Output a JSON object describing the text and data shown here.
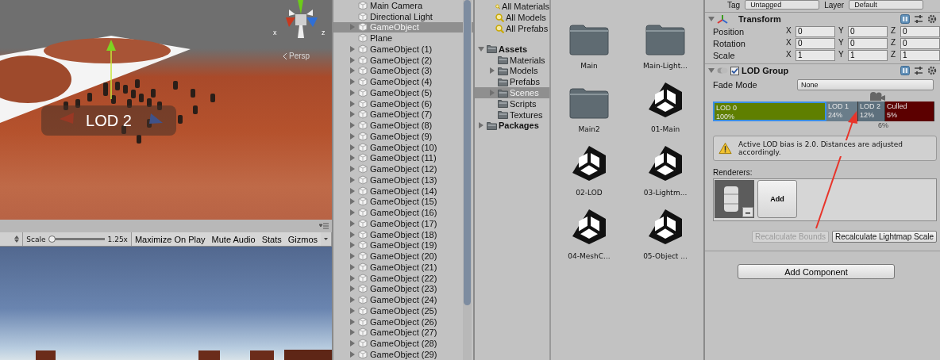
{
  "scene_view": {
    "lod_label": "LOD 2",
    "projection": "Persp",
    "axes": [
      "x",
      "z"
    ]
  },
  "game_view": {
    "toolbar": {
      "scale_label": "Scale",
      "scale": {
        "level": 0.0,
        "reading": "1.25x"
      },
      "buttons": [
        {
          "label": "Maximize On Play",
          "kind": "toggle"
        },
        {
          "label": "Mute Audio",
          "kind": "toggle"
        },
        {
          "label": "Stats",
          "kind": "toggle"
        },
        {
          "label": "Gizmos",
          "kind": "dropdown"
        }
      ]
    }
  },
  "hierarchy": {
    "items": [
      {
        "label": "Main Camera",
        "selected": false,
        "expandable": false
      },
      {
        "label": "Directional Light",
        "selected": false,
        "expandable": false
      },
      {
        "label": "GameObject",
        "selected": true,
        "expandable": true
      },
      {
        "label": "Plane",
        "selected": false,
        "expandable": false
      },
      {
        "label": "GameObject (1)",
        "selected": false,
        "expandable": true
      },
      {
        "label": "GameObject (2)",
        "selected": false,
        "expandable": true
      },
      {
        "label": "GameObject (3)",
        "selected": false,
        "expandable": true
      },
      {
        "label": "GameObject (4)",
        "selected": false,
        "expandable": true
      },
      {
        "label": "GameObject (5)",
        "selected": false,
        "expandable": true
      },
      {
        "label": "GameObject (6)",
        "selected": false,
        "expandable": true
      },
      {
        "label": "GameObject (7)",
        "selected": false,
        "expandable": true
      },
      {
        "label": "GameObject (8)",
        "selected": false,
        "expandable": true
      },
      {
        "label": "GameObject (9)",
        "selected": false,
        "expandable": true
      },
      {
        "label": "GameObject (10)",
        "selected": false,
        "expandable": true
      },
      {
        "label": "GameObject (11)",
        "selected": false,
        "expandable": true
      },
      {
        "label": "GameObject (12)",
        "selected": false,
        "expandable": true
      },
      {
        "label": "GameObject (13)",
        "selected": false,
        "expandable": true
      },
      {
        "label": "GameObject (14)",
        "selected": false,
        "expandable": true
      },
      {
        "label": "GameObject (15)",
        "selected": false,
        "expandable": true
      },
      {
        "label": "GameObject (16)",
        "selected": false,
        "expandable": true
      },
      {
        "label": "GameObject (17)",
        "selected": false,
        "expandable": true
      },
      {
        "label": "GameObject (18)",
        "selected": false,
        "expandable": true
      },
      {
        "label": "GameObject (19)",
        "selected": false,
        "expandable": true
      },
      {
        "label": "GameObject (20)",
        "selected": false,
        "expandable": true
      },
      {
        "label": "GameObject (21)",
        "selected": false,
        "expandable": true
      },
      {
        "label": "GameObject (22)",
        "selected": false,
        "expandable": true
      },
      {
        "label": "GameObject (23)",
        "selected": false,
        "expandable": true
      },
      {
        "label": "GameObject (24)",
        "selected": false,
        "expandable": true
      },
      {
        "label": "GameObject (25)",
        "selected": false,
        "expandable": true
      },
      {
        "label": "GameObject (26)",
        "selected": false,
        "expandable": true
      },
      {
        "label": "GameObject (27)",
        "selected": false,
        "expandable": true
      },
      {
        "label": "GameObject (28)",
        "selected": false,
        "expandable": true
      },
      {
        "label": "GameObject (29)",
        "selected": false,
        "expandable": true
      }
    ]
  },
  "project": {
    "favorites": [
      "All Materials",
      "All Models",
      "All Prefabs"
    ],
    "tree": [
      {
        "label": "Assets",
        "expanded": true,
        "selected": false,
        "children": [
          {
            "label": "Materials",
            "expanded": false,
            "selected": false,
            "expandable": false
          },
          {
            "label": "Models",
            "expanded": false,
            "selected": false,
            "expandable": true
          },
          {
            "label": "Prefabs",
            "expanded": false,
            "selected": false,
            "expandable": false
          },
          {
            "label": "Scenes",
            "expanded": false,
            "selected": true,
            "expandable": true
          },
          {
            "label": "Scripts",
            "expanded": false,
            "selected": false,
            "expandable": false
          },
          {
            "label": "Textures",
            "expanded": false,
            "selected": false,
            "expandable": false
          }
        ],
        "expandable": true
      },
      {
        "label": "Packages",
        "expanded": false,
        "selected": false,
        "expandable": true
      }
    ],
    "assets": [
      {
        "name": "Main",
        "kind": "folder"
      },
      {
        "name": "Main-Light...",
        "kind": "folder"
      },
      {
        "name": "Main2",
        "kind": "folder"
      },
      {
        "name": "01-Main",
        "kind": "scene"
      },
      {
        "name": "02-LOD",
        "kind": "scene"
      },
      {
        "name": "03-Lightm...",
        "kind": "scene"
      },
      {
        "name": "04-MeshC...",
        "kind": "scene"
      },
      {
        "name": "05-Object ...",
        "kind": "scene"
      }
    ]
  },
  "inspector": {
    "tag_label": "Tag",
    "tag": "Untagged",
    "layer_label": "Layer",
    "layer": "Default",
    "transform": {
      "title": "Transform",
      "rows": [
        {
          "label": "Position",
          "fields": [
            {
              "axis": "X",
              "value": "0"
            },
            {
              "axis": "Y",
              "value": "0"
            },
            {
              "axis": "Z",
              "value": "0"
            }
          ]
        },
        {
          "label": "Rotation",
          "fields": [
            {
              "axis": "X",
              "value": "0"
            },
            {
              "axis": "Y",
              "value": "0"
            },
            {
              "axis": "Z",
              "value": "0"
            }
          ]
        },
        {
          "label": "Scale",
          "fields": [
            {
              "axis": "X",
              "value": "1"
            },
            {
              "axis": "Y",
              "value": "1"
            },
            {
              "axis": "Z",
              "value": "1"
            }
          ]
        }
      ]
    },
    "lod_group": {
      "title": "LOD Group",
      "enabled": true,
      "fade_mode_label": "Fade Mode",
      "fade_mode": "None",
      "levels": [
        {
          "label": "LOD 0",
          "percent": "100%",
          "color": "#5f7f00",
          "selected": true
        },
        {
          "label": "LOD 1",
          "percent": "24%",
          "color": "#6a7d8a",
          "selected": false
        },
        {
          "label": "LOD 2",
          "percent": "12%",
          "color": "#5d707d",
          "selected": false
        },
        {
          "label": "Culled",
          "percent": "5%",
          "color": "#5c0000",
          "selected": false
        }
      ],
      "camera_percent": "6%",
      "warning": "Active LOD bias is 2.0. Distances are adjusted accordingly.",
      "renderers_label": "Renderers:",
      "add_label": "Add",
      "buttons": [
        {
          "label": "Recalculate Bounds",
          "disabled": true
        },
        {
          "label": "Recalculate Lightmap Scale",
          "disabled": false
        }
      ]
    },
    "add_component": "Add Component"
  }
}
